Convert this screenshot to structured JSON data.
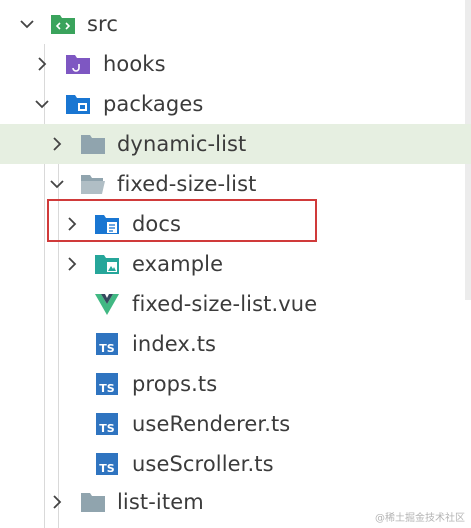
{
  "tree": {
    "items": [
      {
        "label": "src",
        "expanded": true,
        "icon": "src-folder-icon"
      },
      {
        "label": "hooks",
        "expanded": false,
        "icon": "hooks-folder-icon"
      },
      {
        "label": "packages",
        "expanded": true,
        "icon": "packages-folder-icon"
      },
      {
        "label": "dynamic-list",
        "expanded": false,
        "icon": "folder-icon",
        "selected": true
      },
      {
        "label": "fixed-size-list",
        "expanded": true,
        "icon": "folder-open-icon"
      },
      {
        "label": "docs",
        "expanded": false,
        "icon": "docs-folder-icon",
        "highlighted": true
      },
      {
        "label": "example",
        "expanded": false,
        "icon": "example-folder-icon"
      },
      {
        "label": "fixed-size-list.vue",
        "icon": "vue-icon"
      },
      {
        "label": "index.ts",
        "icon": "typescript-icon"
      },
      {
        "label": "props.ts",
        "icon": "typescript-icon"
      },
      {
        "label": "useRenderer.ts",
        "icon": "typescript-icon"
      },
      {
        "label": "useScroller.ts",
        "icon": "typescript-icon"
      },
      {
        "label": "list-item",
        "expanded": false,
        "icon": "folder-icon"
      }
    ],
    "ts_glyph": "TS"
  },
  "colors": {
    "selected_row": "#e6efe1",
    "highlight_border": "#d03a3a",
    "src_folder": "#3aa35c",
    "hooks_folder": "#7e57c2",
    "blue_folder": "#1976d2",
    "grey_folder": "#90a4ae",
    "teal_folder": "#26a69a",
    "ts_blue": "#2f74c0"
  },
  "watermark": "@稀土掘金技术社区"
}
